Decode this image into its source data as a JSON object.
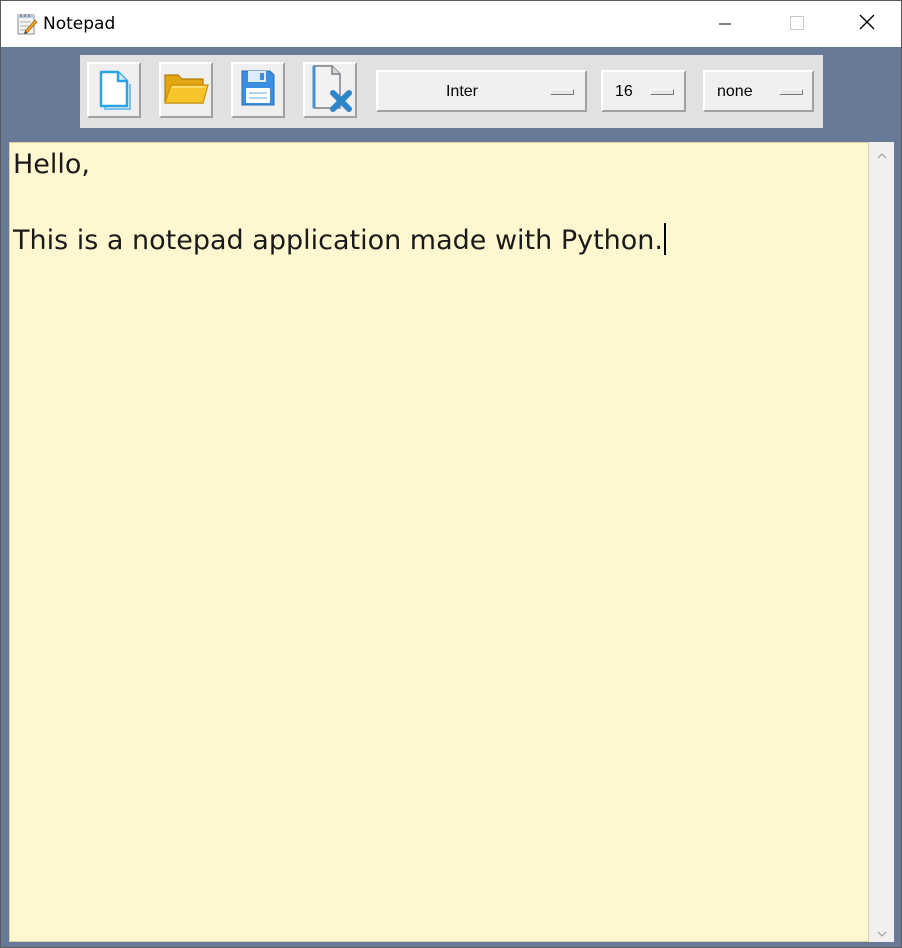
{
  "window": {
    "title": "Notepad",
    "icon": "notepad-app-icon",
    "controls": {
      "minimize_icon": "minimize-icon",
      "maximize_icon": "maximize-icon",
      "close_icon": "close-icon"
    }
  },
  "toolbar": {
    "buttons": [
      {
        "icon": "new-file-icon"
      },
      {
        "icon": "open-folder-icon"
      },
      {
        "icon": "save-floppy-icon"
      },
      {
        "icon": "clear-document-icon"
      }
    ],
    "font_family": "Inter",
    "font_size": "16",
    "font_style": "none"
  },
  "editor": {
    "lines": [
      "Hello,",
      "This is a notepad application made with Python."
    ]
  },
  "colors": {
    "background": "#687a98",
    "toolbar": "#e1e1e1",
    "editor_background": "#fef7cf",
    "save_icon": "#3a8fe0",
    "folder_icon": "#f5c022"
  }
}
